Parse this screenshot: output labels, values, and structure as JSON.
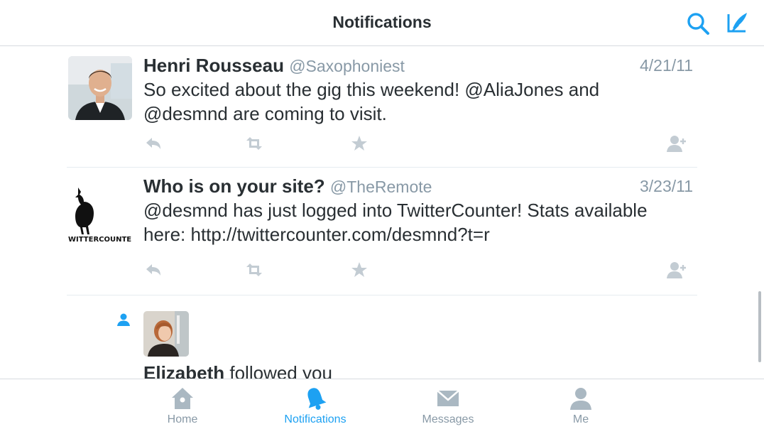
{
  "header": {
    "title": "Notifications",
    "search_icon": "search-icon",
    "compose_icon": "compose-tweet-icon"
  },
  "tweets": [
    {
      "name": "Henri Rousseau",
      "handle": "@Saxophoniest",
      "date": "4/21/11",
      "text_line1": "So excited about the gig this weekend! @AliaJones and",
      "text_line2": "@desmnd are coming to visit."
    },
    {
      "name": "Who is on your site?",
      "handle": "@TheRemote",
      "date": "3/23/11",
      "text_line1": "@desmnd has just logged into TwitterCounter! Stats available",
      "text_line2": "here: http://twittercounter.com/desmnd?t=r",
      "avatar_logo_text": "TWITTERCOUNTER"
    }
  ],
  "follow": {
    "name": "Elizabeth",
    "action": "followed you"
  },
  "tabbar": {
    "tabs": [
      {
        "label": "Home",
        "icon": "home-icon"
      },
      {
        "label": "Notifications",
        "icon": "bell-icon"
      },
      {
        "label": "Messages",
        "icon": "envelope-icon"
      },
      {
        "label": "Me",
        "icon": "person-icon"
      }
    ],
    "active_index": 1
  },
  "colors": {
    "accent": "#1da1f2",
    "muted": "#8899a6",
    "text": "#292f33",
    "icon_gray": "#aab8c2"
  }
}
